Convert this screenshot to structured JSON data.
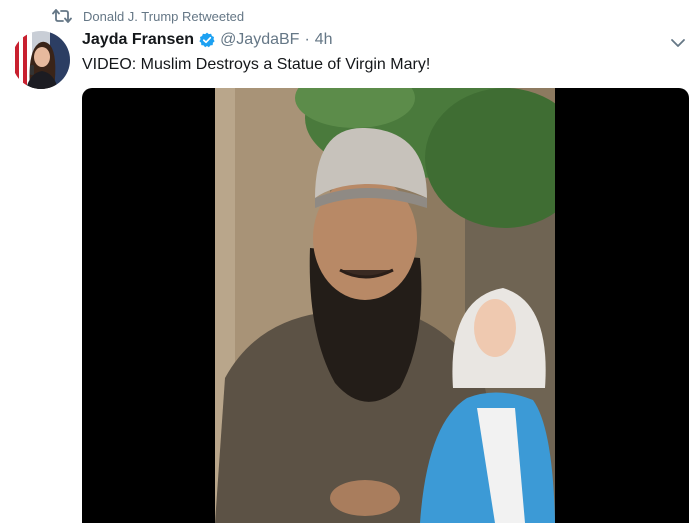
{
  "retweet": {
    "icon": "retweet-icon",
    "text": "Donald J. Trump Retweeted"
  },
  "author": {
    "name": "Jayda Fransen",
    "verified": true,
    "handle": "@JaydaBF",
    "separator": "·",
    "time": "4h"
  },
  "tweet": {
    "text": "VIDEO: Muslim Destroys a Statue of Virgin Mary!"
  },
  "colors": {
    "secondary_text": "#657786",
    "primary_text": "#14171a",
    "verified_blue": "#1da1f2",
    "video_background": "#000000"
  }
}
